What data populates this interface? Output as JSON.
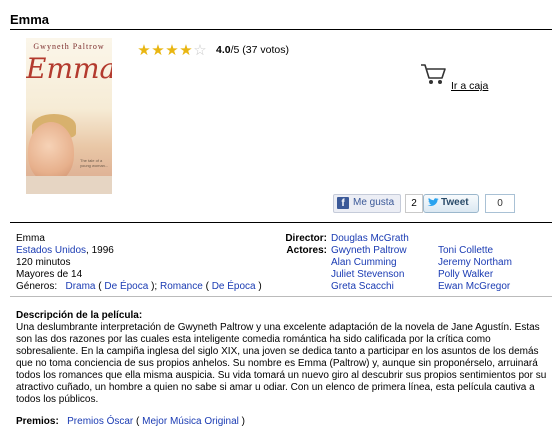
{
  "movie": {
    "title": "Emma",
    "poster": {
      "actor_text": "Gwyneth Paltrow",
      "title_text": "Emma",
      "tagline_text": "The tale of a young woman..."
    },
    "rating": {
      "stars_filled": 4,
      "stars_total": 5,
      "score": "4.0",
      "suffix": "/5 (37 votos)"
    },
    "checkout_link": "Ir a caja",
    "social": {
      "like_label": "Me gusta",
      "like_count": "2",
      "tweet_label": "Tweet",
      "tweet_count": "0"
    },
    "info": {
      "title_line": "Emma",
      "country": "Estados Unidos",
      "year": ", 1996",
      "duration": "120 minutos",
      "age": "Mayores de 14",
      "genres_label": "Géneros:",
      "genre1": "Drama",
      "genre1_sub": "De Época",
      "genre2": "Romance",
      "genre2_sub": "De Época",
      "director_label": "Director:",
      "director": "Douglas McGrath",
      "actors_label": "Actores:",
      "actors_col1": [
        "Gwyneth Paltrow",
        "Alan Cumming",
        "Juliet Stevenson",
        "Greta Scacchi"
      ],
      "actors_col2": [
        "Toni Collette",
        "Jeremy Northam",
        "Polly Walker",
        "Ewan McGregor"
      ]
    },
    "description": {
      "heading": "Descripción de la película:",
      "text": "Una deslumbrante interpretación de Gwyneth Paltrow y una excelente adaptación de la novela de Jane Agustín. Estas son las dos razones por las cuales esta inteligente comedia romántica ha sido calificada por la crítica como sobresaliente. En la campiña inglesa del siglo XIX, una joven se dedica tanto a participar en los asuntos de los demás que no toma conciencia de sus propios anhelos. Su nombre es Emma (Paltrow) y, aunque sin proponérselo, arruinará todos los romances que ella misma auspicia. Su vida tomará un nuevo giro al descubrir sus propios sentimientos por su atractivo cuñado, un hombre a quien no sabe si amar u odiar. Con un elenco de primera línea, esta película cautiva a todos los públicos."
    },
    "awards": {
      "label": "Premios:",
      "award": "Premios Óscar",
      "award_sub": "Mejor Música Original"
    }
  },
  "colors": {
    "link": "#1a3bb3",
    "star": "#e9b612",
    "facebook": "#3b5998"
  },
  "icons": [
    "shopping-cart-icon",
    "facebook-icon",
    "twitter-bird-icon",
    "star-icon"
  ]
}
